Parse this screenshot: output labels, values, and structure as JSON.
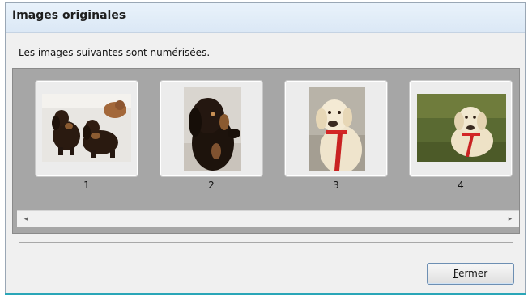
{
  "window": {
    "title": "Images originales",
    "description": "Les images suivantes sont numérisées."
  },
  "thumbnails": [
    {
      "label": "1",
      "icon": "two-dachshunds-photo"
    },
    {
      "label": "2",
      "icon": "dachshund-portrait-photo"
    },
    {
      "label": "3",
      "icon": "labrador-red-leash-photo"
    },
    {
      "label": "4",
      "icon": "labrador-grass-photo"
    }
  ],
  "scrollbar": {
    "left_arrow": "◂",
    "right_arrow": "▸"
  },
  "buttons": {
    "close_mnemonic": "F",
    "close_rest": "ermer"
  },
  "colors": {
    "title_bar": "#dbe8f5",
    "panel_bg": "#a6a6a6",
    "window_bg": "#f0f0f0",
    "button_border": "#6d8fb3"
  }
}
